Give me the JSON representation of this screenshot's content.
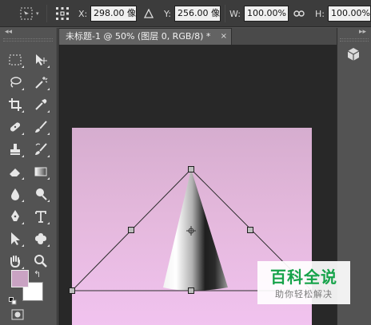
{
  "options_bar": {
    "x_label": "X:",
    "x_value": "298.00 像",
    "delta_icon": "triangle-icon",
    "y_label": "Y:",
    "y_value": "256.00 像",
    "w_label": "W:",
    "w_value": "100.00%",
    "link_icon": "link-icon",
    "h_label": "H:",
    "h_value": "100.00%"
  },
  "document": {
    "tab_title": "未标题-1 @ 50% (图层 0, RGB/8) *",
    "tab_close": "×"
  },
  "tools_panel": {
    "collapse_label": "◂◂",
    "tools": [
      "rectangular-marquee-icon",
      "move-icon",
      "lasso-icon",
      "magic-wand-icon",
      "crop-icon",
      "eyedropper-icon",
      "healing-brush-icon",
      "brush-icon",
      "clone-stamp-icon",
      "history-brush-icon",
      "eraser-icon",
      "gradient-icon",
      "blur-icon",
      "dodge-icon",
      "pen-icon",
      "type-icon",
      "path-selection-icon",
      "custom-shape-icon",
      "hand-icon",
      "zoom-icon"
    ],
    "foreground_color": "#c9a3c3",
    "background_color": "#ffffff"
  },
  "right_dock": {
    "collapse_label": "▸▸",
    "panel_icon": "3d-cube-icon"
  },
  "canvas": {
    "gradient_top": "#d6adcf",
    "gradient_bottom": "#f1c3ef"
  },
  "watermark": {
    "title": "百科全说",
    "subtitle": "助你轻松解决",
    "color": "#16a34a"
  }
}
